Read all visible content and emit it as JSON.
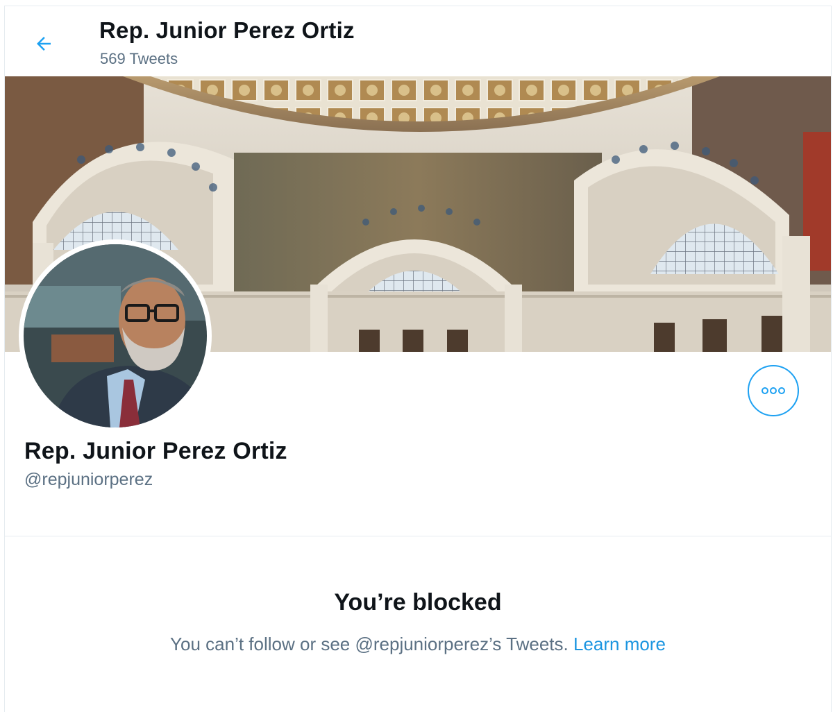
{
  "header": {
    "title": "Rep. Junior Perez Ortiz",
    "tweet_count": "569 Tweets"
  },
  "profile": {
    "name": "Rep. Junior Perez Ortiz",
    "handle": "@repjuniorperez"
  },
  "blocked": {
    "title": "You’re blocked",
    "message_prefix": "You can’t follow or see @repjuniorperez’s Tweets.",
    "learn_more": "Learn more"
  },
  "colors": {
    "accent": "#1da1f2",
    "secondary_text": "#5b7083",
    "primary_text": "#0f1419"
  },
  "icons": {
    "back": "arrow-left-icon",
    "more": "more-horizontal-icon"
  }
}
